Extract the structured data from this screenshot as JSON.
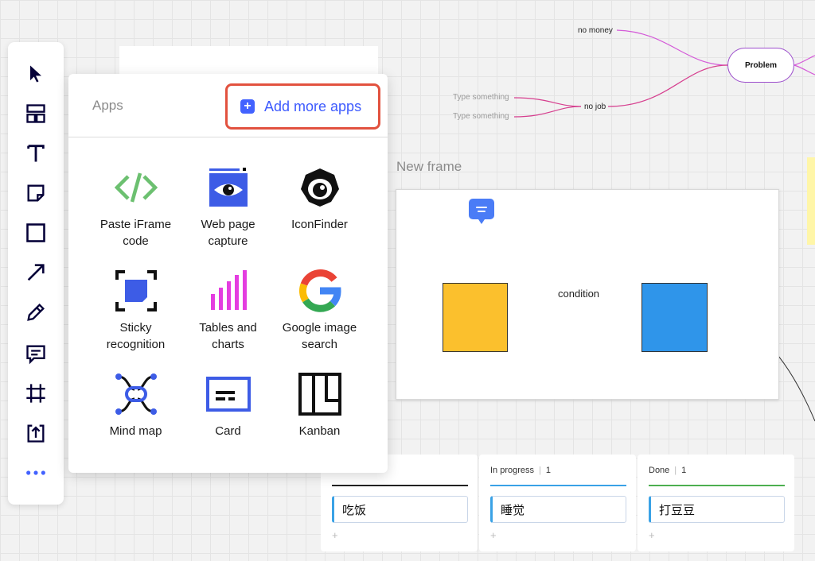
{
  "toolbar": {
    "tools": [
      {
        "name": "select-tool",
        "icon": "cursor-icon"
      },
      {
        "name": "templates-tool",
        "icon": "layout-icon"
      },
      {
        "name": "text-tool",
        "icon": "text-icon"
      },
      {
        "name": "sticky-note-tool",
        "icon": "sticky-note-icon"
      },
      {
        "name": "shape-tool",
        "icon": "square-icon"
      },
      {
        "name": "connection-line-tool",
        "icon": "arrow-icon"
      },
      {
        "name": "pen-tool",
        "icon": "pen-icon"
      },
      {
        "name": "comment-tool",
        "icon": "comment-icon"
      },
      {
        "name": "frame-tool",
        "icon": "frame-icon"
      },
      {
        "name": "upload-tool",
        "icon": "upload-icon"
      },
      {
        "name": "more-tools",
        "icon": "more-icon"
      }
    ]
  },
  "apps_panel": {
    "title": "Apps",
    "add_button_label": "Add more apps",
    "apps": [
      {
        "label": "Paste iFrame code",
        "icon": "code-icon"
      },
      {
        "label": "Web page capture",
        "icon": "eye-capture-icon"
      },
      {
        "label": "IconFinder",
        "icon": "iconfinder-icon"
      },
      {
        "label": "Sticky recognition",
        "icon": "sticky-recognition-icon"
      },
      {
        "label": "Tables and charts",
        "icon": "bar-chart-icon"
      },
      {
        "label": "Google image search",
        "icon": "google-icon"
      },
      {
        "label": "Mind map",
        "icon": "mind-map-icon"
      },
      {
        "label": "Card",
        "icon": "card-icon"
      },
      {
        "label": "Kanban",
        "icon": "kanban-icon"
      }
    ]
  },
  "mindmap": {
    "root": "Problem",
    "branches": [
      "no money",
      "no job"
    ],
    "placeholders": [
      "Type something",
      "Type something"
    ]
  },
  "frame": {
    "title": "New frame",
    "connector_label": "condition"
  },
  "kanban": {
    "columns": [
      {
        "title": "",
        "count": "",
        "card": "吃饭",
        "color": "#222222"
      },
      {
        "title": "In progress",
        "count": "1",
        "card": "睡觉",
        "color": "#3aa2e6"
      },
      {
        "title": "Done",
        "count": "1",
        "card": "打豆豆",
        "color": "#4caf50"
      }
    ],
    "add_symbol": "+"
  },
  "colors": {
    "accent": "#4262ff",
    "highlight_border": "#e2523f",
    "mindmap_magenta": "#d63fa6"
  }
}
